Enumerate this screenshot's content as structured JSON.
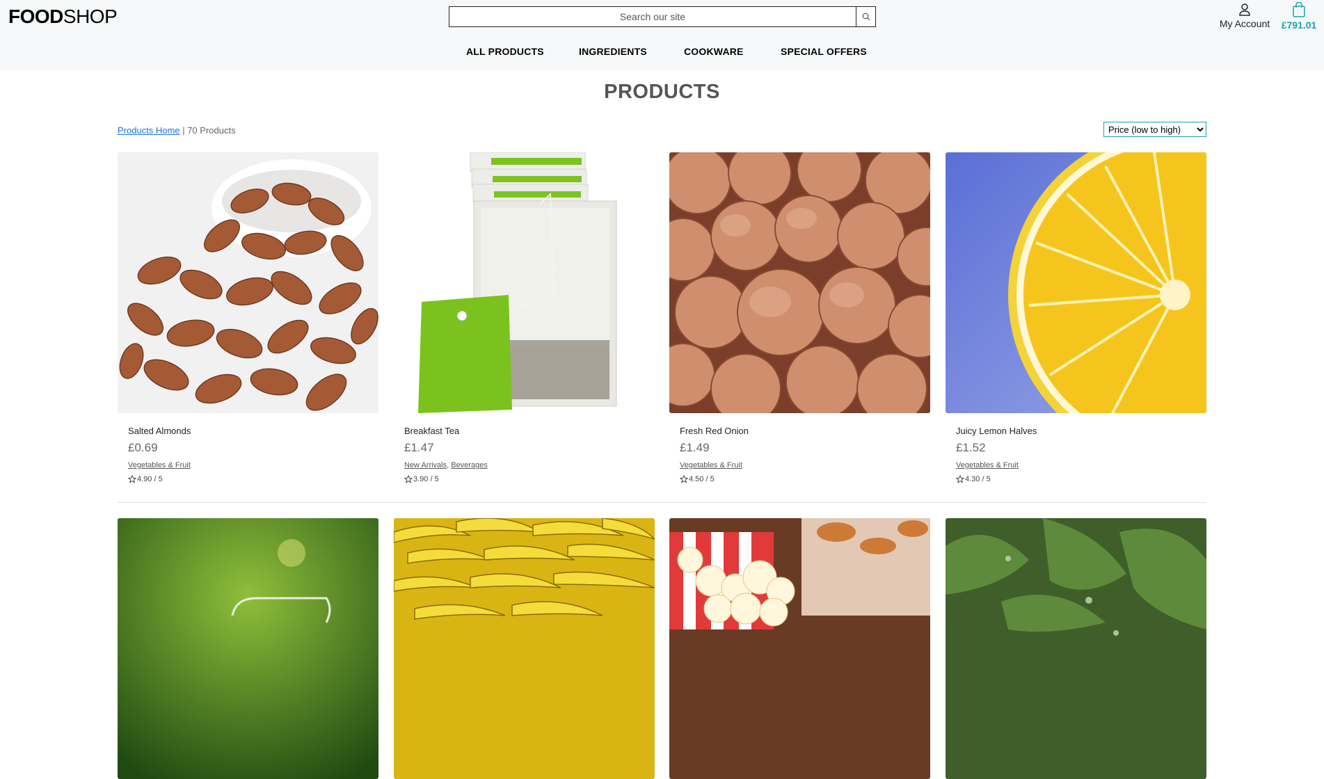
{
  "header": {
    "logo_bold": "FOOD",
    "logo_rest": "SHOP",
    "search_placeholder": "Search our site",
    "account_label": "My Account",
    "cart_total": "£791.01"
  },
  "nav": [
    "ALL PRODUCTS",
    "INGREDIENTS",
    "COOKWARE",
    "SPECIAL OFFERS"
  ],
  "page": {
    "title": "PRODUCTS",
    "breadcrumb_link": "Products Home",
    "product_count": "70 Products",
    "sort_selected": "Price (low to high)"
  },
  "products": [
    {
      "name": "Salted Almonds",
      "price": "£0.69",
      "categories": [
        "Vegetables & Fruit"
      ],
      "rating": "4.90 / 5"
    },
    {
      "name": "Breakfast Tea",
      "price": "£1.47",
      "categories": [
        "New Arrivals",
        "Beverages"
      ],
      "rating": "3.90 / 5"
    },
    {
      "name": "Fresh Red Onion",
      "price": "£1.49",
      "categories": [
        "Vegetables & Fruit"
      ],
      "rating": "4.50 / 5"
    },
    {
      "name": "Juicy Lemon Halves",
      "price": "£1.52",
      "categories": [
        "Vegetables & Fruit"
      ],
      "rating": "4.30 / 5"
    }
  ],
  "colors": {
    "accent": "#17a2b8",
    "link": "#1a73e8",
    "header_bg": "#f6f8fa"
  }
}
